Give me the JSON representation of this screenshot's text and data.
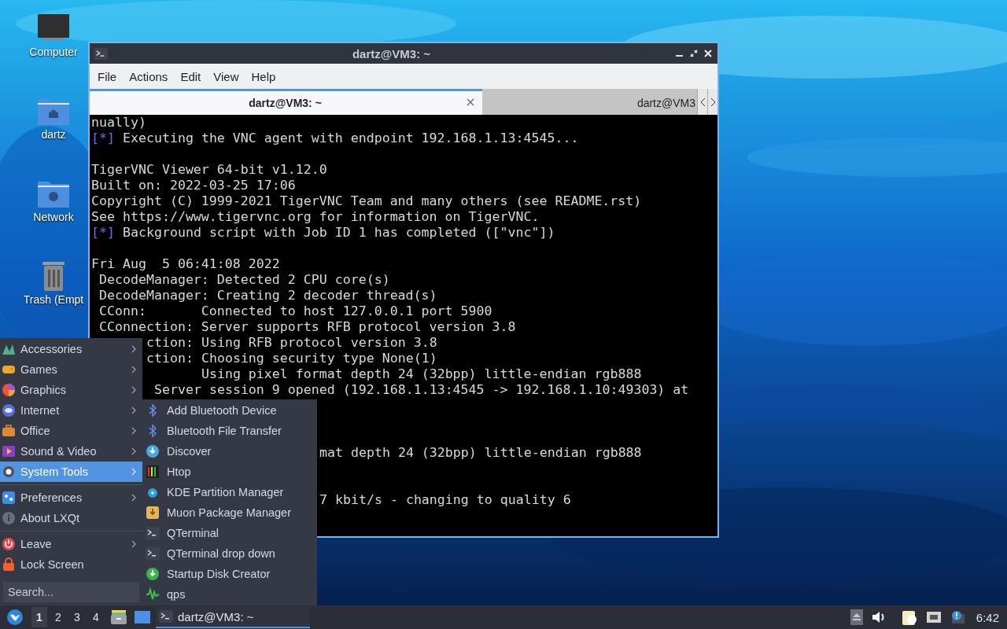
{
  "desktop_icons": [
    {
      "label": "Computer"
    },
    {
      "label": "dartz"
    },
    {
      "label": "Network"
    },
    {
      "label": "Trash (Empt"
    }
  ],
  "window": {
    "title": "dartz@VM3: ~",
    "active": true,
    "menu": [
      "File",
      "Actions",
      "Edit",
      "View",
      "Help"
    ],
    "tabs": [
      {
        "label": "dartz@VM3: ~",
        "selected": true,
        "closable": true
      },
      {
        "label": "dartz@VM3",
        "selected": false,
        "closable": false
      }
    ],
    "terminal_lines": [
      {
        "kind": "plain",
        "text": "nually)"
      },
      {
        "kind": "status",
        "marker": "[*]",
        "text": "Executing the VNC agent with endpoint 192.168.1.13:4545..."
      },
      {
        "kind": "blank"
      },
      {
        "kind": "plain",
        "text": "TigerVNC Viewer 64-bit v1.12.0"
      },
      {
        "kind": "plain",
        "text": "Built on: 2022-03-25 17:06"
      },
      {
        "kind": "plain",
        "text": "Copyright (C) 1999-2021 TigerVNC Team and many others (see README.rst)"
      },
      {
        "kind": "plain",
        "text": "See https://www.tigervnc.org for information on TigerVNC."
      },
      {
        "kind": "status",
        "marker": "[*]",
        "text": "Background script with Job ID 1 has completed ([\"vnc\"])"
      },
      {
        "kind": "blank"
      },
      {
        "kind": "plain",
        "text": "Fri Aug  5 06:41:08 2022"
      },
      {
        "kind": "plain",
        "text": " DecodeManager: Detected 2 CPU core(s)"
      },
      {
        "kind": "plain",
        "text": " DecodeManager: Creating 2 decoder thread(s)"
      },
      {
        "kind": "plain",
        "text": " CConn:       Connected to host 127.0.0.1 port 5900"
      },
      {
        "kind": "plain",
        "text": " CConnection: Server supports RFB protocol version 3.8"
      },
      {
        "kind": "behind_menu",
        "text": "ction: Using RFB protocol version 3.8"
      },
      {
        "kind": "behind_menu",
        "text": "ction: Choosing security type None(1)"
      },
      {
        "kind": "behind_menu",
        "text": "       Using pixel format depth 24 (32bpp) little-endian rgb888"
      },
      {
        "kind": "behind_menu",
        "text": " Server session 9 opened (192.168.1.13:4545 -> 192.168.1.10:49303) at"
      },
      {
        "kind": "blank"
      },
      {
        "kind": "blank"
      },
      {
        "kind": "blank"
      },
      {
        "kind": "behind_submenu",
        "text": "mat depth 24 (32bpp) little-endian rgb888"
      },
      {
        "kind": "blank"
      },
      {
        "kind": "blank"
      },
      {
        "kind": "behind_submenu",
        "text": "7 kbit/s - changing to quality 6"
      }
    ]
  },
  "main_menu": {
    "groups": [
      [
        {
          "label": "Accessories",
          "submenu": true,
          "selected": false
        },
        {
          "label": "Games",
          "submenu": true,
          "selected": false
        },
        {
          "label": "Graphics",
          "submenu": true,
          "selected": false
        },
        {
          "label": "Internet",
          "submenu": true,
          "selected": false
        },
        {
          "label": "Office",
          "submenu": true,
          "selected": false
        },
        {
          "label": "Sound & Video",
          "submenu": true,
          "selected": false
        },
        {
          "label": "System Tools",
          "submenu": true,
          "selected": true
        }
      ],
      [
        {
          "label": "Preferences",
          "submenu": true,
          "selected": false
        },
        {
          "label": "About LXQt",
          "submenu": false,
          "selected": false
        }
      ],
      [
        {
          "label": "Leave",
          "submenu": true,
          "selected": false
        },
        {
          "label": "Lock Screen",
          "submenu": false,
          "selected": false
        }
      ]
    ],
    "search": {
      "placeholder": "Search..."
    }
  },
  "submenu": [
    {
      "label": "Add Bluetooth Device"
    },
    {
      "label": "Bluetooth File Transfer"
    },
    {
      "label": "Discover"
    },
    {
      "label": "Htop"
    },
    {
      "label": "KDE Partition Manager"
    },
    {
      "label": "Muon Package Manager"
    },
    {
      "label": "QTerminal"
    },
    {
      "label": "QTerminal drop down"
    },
    {
      "label": "Startup Disk Creator"
    },
    {
      "label": "qps"
    }
  ],
  "taskbar": {
    "desktops": [
      {
        "label": "1",
        "selected": true
      },
      {
        "label": "2",
        "selected": false
      },
      {
        "label": "3",
        "selected": false
      },
      {
        "label": "4",
        "selected": false
      }
    ],
    "tasks": [
      {
        "label": "dartz@VM3: ~",
        "selected": true
      }
    ],
    "clock": "6:42"
  }
}
